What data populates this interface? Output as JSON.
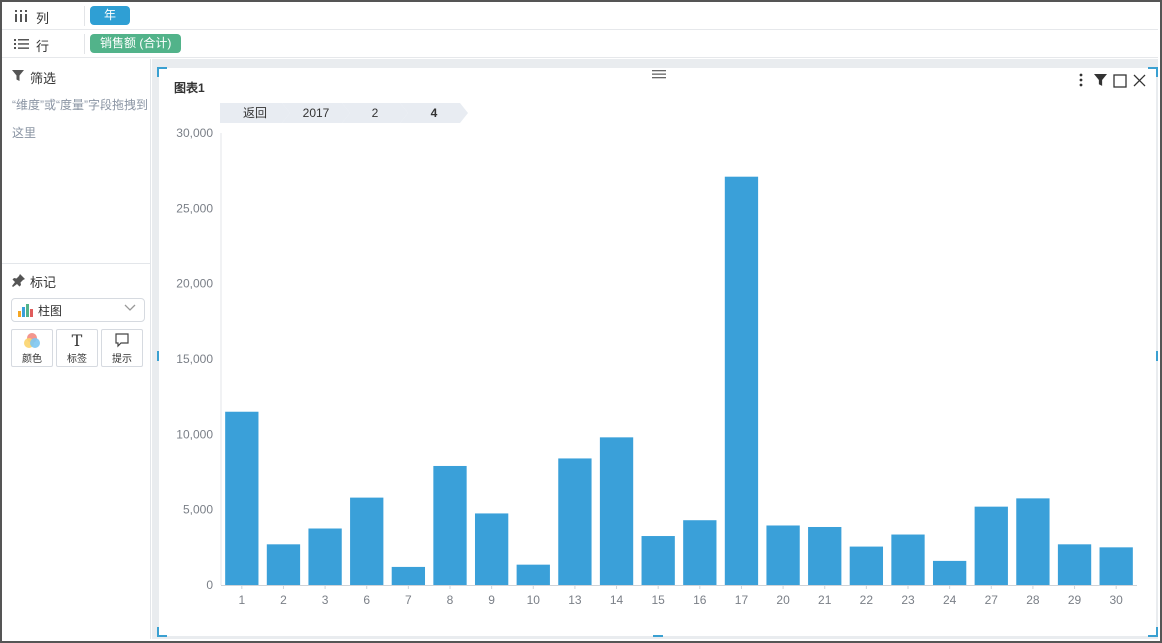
{
  "shelves": {
    "columns": {
      "label": "列",
      "pill": "年"
    },
    "rows": {
      "label": "行",
      "pill": "销售额 (合计)"
    }
  },
  "filter": {
    "title": "筛选",
    "hint": "“维度”或“度量”字段拖拽到这里"
  },
  "marks": {
    "title": "标记",
    "chart_type": "柱图",
    "buttons": {
      "color": "颜色",
      "label": "标签",
      "tooltip": "提示"
    }
  },
  "chart": {
    "title": "图表1",
    "breadcrumb": [
      "返回",
      "2017",
      "2",
      "4"
    ]
  },
  "colors": {
    "bar": "#3aa0d9",
    "accent": "#2f9fd4",
    "pill_green": "#52b38a"
  },
  "icons": {
    "columns_shelf": "columns-icon",
    "rows_shelf": "rows-list-icon",
    "filter": "funnel-icon",
    "marks": "pin-icon",
    "more": "vertical-dots-icon",
    "card_filter": "funnel-icon",
    "maximize": "square-icon",
    "close": "close-icon"
  },
  "chart_data": {
    "type": "bar",
    "categories": [
      "1",
      "2",
      "3",
      "6",
      "7",
      "8",
      "9",
      "10",
      "13",
      "14",
      "15",
      "16",
      "17",
      "20",
      "21",
      "22",
      "23",
      "24",
      "27",
      "28",
      "29",
      "30"
    ],
    "values": [
      11500,
      2700,
      3750,
      5800,
      1200,
      7900,
      4750,
      1350,
      8400,
      9800,
      3250,
      4300,
      27100,
      3950,
      3850,
      2550,
      3350,
      1600,
      5200,
      5750,
      2700,
      2500
    ],
    "title": "图表1",
    "xlabel": "",
    "ylabel": "",
    "ylim": [
      0,
      30000
    ],
    "yticks": [
      "0",
      "5,000",
      "10,000",
      "15,000",
      "20,000",
      "25,000",
      "30,000"
    ],
    "grid": false,
    "legend": "none"
  }
}
